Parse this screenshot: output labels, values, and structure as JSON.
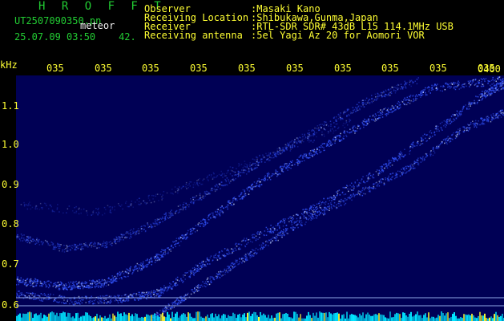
{
  "header": {
    "program_title": "H R O F F T",
    "file_name": "UT2507090350.pn",
    "event_type": "meteor",
    "date_time": "25.07.09 03:50",
    "count": "42."
  },
  "info": {
    "labels": [
      "Observer",
      "Receiving Location",
      "Receiver",
      "Receiving antenna"
    ],
    "values": [
      ":Masaki Kano",
      ":Shibukawa,Gunma,Japan",
      ":RTL-SDR SDR# 43dB L15 114.1MHz USB",
      ":5el Yagi Az 20 for Aomori VOR"
    ]
  },
  "spectrogram": {
    "unit_label": "kHz",
    "y_ticks": [
      "1.1",
      "1.0",
      "0.9",
      "0.8",
      "0.7",
      "0.6"
    ],
    "x_ticks": [
      "035",
      "035",
      "035",
      "035",
      "035",
      "035",
      "035",
      "035",
      "035",
      "035",
      "0400"
    ],
    "colors": {
      "background": "#000055",
      "trace": "#3355ff",
      "trace_bright": "#ccddff",
      "hline": "#8fa7e6",
      "bottom_bar": "#00e5ff"
    }
  }
}
